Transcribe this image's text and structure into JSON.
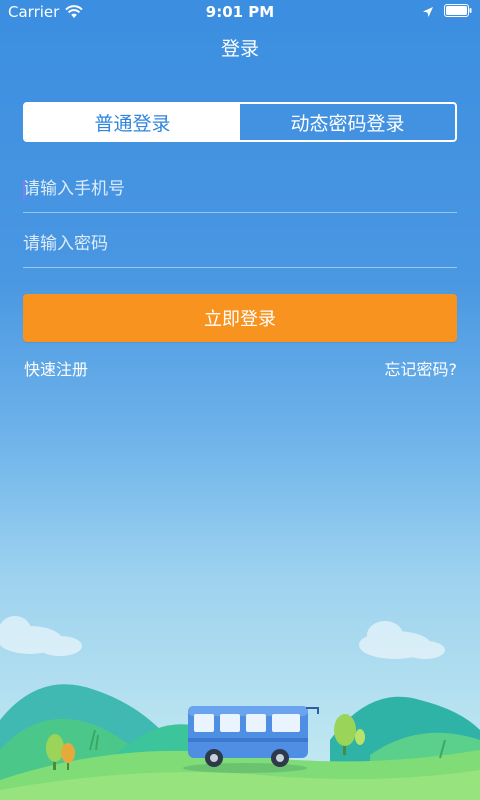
{
  "status_bar": {
    "carrier": "Carrier",
    "time": "9:01 PM",
    "icons": [
      "wifi-icon",
      "location-arrow-icon",
      "battery-icon"
    ]
  },
  "nav": {
    "title": "登录"
  },
  "segmented_control": {
    "tabs": [
      {
        "label": "普通登录",
        "active": true
      },
      {
        "label": "动态密码登录",
        "active": false
      }
    ]
  },
  "form": {
    "phone_placeholder": "请输入手机号",
    "password_placeholder": "请输入密码"
  },
  "actions": {
    "login_label": "立即登录",
    "register_label": "快速注册",
    "forgot_label": "忘记密码?"
  },
  "colors": {
    "accent_orange": "#f8931f",
    "segment_active_text": "#2f86dc",
    "bg_top": "#3b8ee0",
    "bg_bottom": "#c7ecf0"
  }
}
